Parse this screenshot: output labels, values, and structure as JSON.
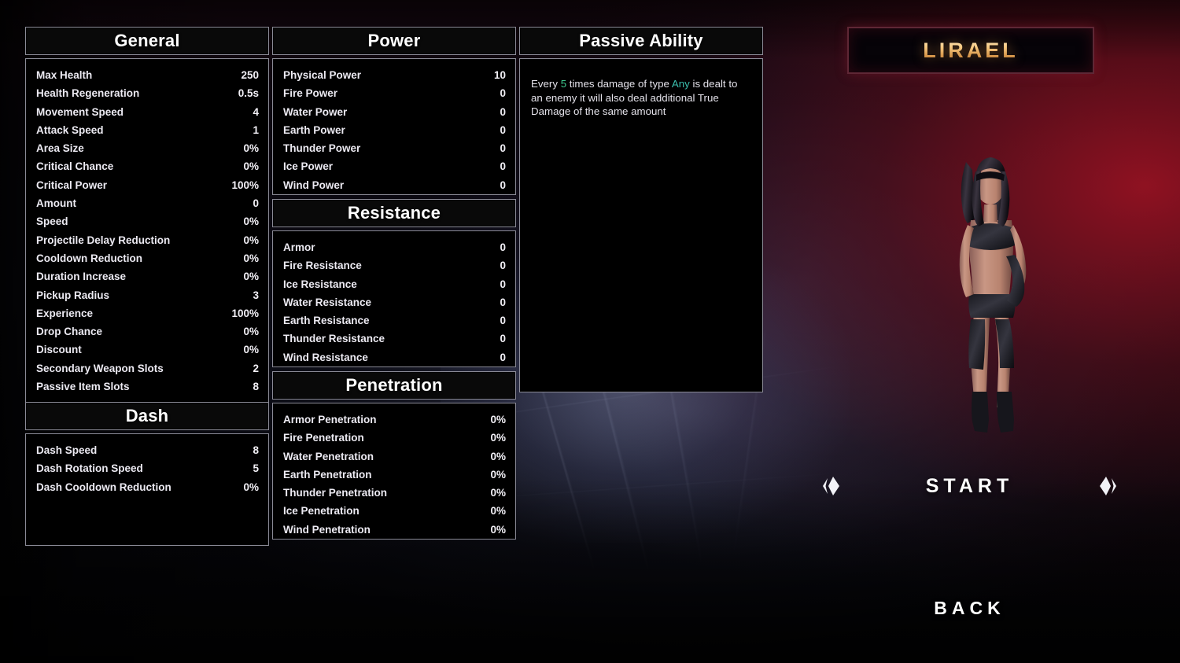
{
  "character": {
    "name": "LIRAEL"
  },
  "panels": {
    "general": {
      "title": "General",
      "rows": [
        {
          "label": "Max Health",
          "value": "250"
        },
        {
          "label": "Health Regeneration",
          "value": "0.5s"
        },
        {
          "label": "Movement Speed",
          "value": "4"
        },
        {
          "label": "Attack Speed",
          "value": "1"
        },
        {
          "label": "Area Size",
          "value": "0%"
        },
        {
          "label": "Critical Chance",
          "value": "0%"
        },
        {
          "label": "Critical Power",
          "value": "100%"
        },
        {
          "label": "Amount",
          "value": "0"
        },
        {
          "label": "Speed",
          "value": "0%"
        },
        {
          "label": "Projectile Delay Reduction",
          "value": "0%"
        },
        {
          "label": "Cooldown Reduction",
          "value": "0%"
        },
        {
          "label": "Duration Increase",
          "value": "0%"
        },
        {
          "label": "Pickup Radius",
          "value": "3"
        },
        {
          "label": "Experience",
          "value": "100%"
        },
        {
          "label": "Drop Chance",
          "value": "0%"
        },
        {
          "label": "Discount",
          "value": "0%"
        },
        {
          "label": "Secondary Weapon Slots",
          "value": "2"
        },
        {
          "label": "Passive Item Slots",
          "value": "8"
        }
      ]
    },
    "dash": {
      "title": "Dash",
      "rows": [
        {
          "label": "Dash Speed",
          "value": "8"
        },
        {
          "label": "Dash Rotation Speed",
          "value": "5"
        },
        {
          "label": "Dash Cooldown Reduction",
          "value": "0%"
        }
      ]
    },
    "power": {
      "title": "Power",
      "rows": [
        {
          "label": "Physical Power",
          "value": "10"
        },
        {
          "label": "Fire Power",
          "value": "0"
        },
        {
          "label": "Water Power",
          "value": "0"
        },
        {
          "label": "Earth Power",
          "value": "0"
        },
        {
          "label": "Thunder Power",
          "value": "0"
        },
        {
          "label": "Ice Power",
          "value": "0"
        },
        {
          "label": "Wind Power",
          "value": "0"
        }
      ]
    },
    "resistance": {
      "title": "Resistance",
      "rows": [
        {
          "label": "Armor",
          "value": "0"
        },
        {
          "label": "Fire Resistance",
          "value": "0"
        },
        {
          "label": "Ice Resistance",
          "value": "0"
        },
        {
          "label": "Water Resistance",
          "value": "0"
        },
        {
          "label": "Earth Resistance",
          "value": "0"
        },
        {
          "label": "Thunder Resistance",
          "value": "0"
        },
        {
          "label": "Wind Resistance",
          "value": "0"
        }
      ]
    },
    "penetration": {
      "title": "Penetration",
      "rows": [
        {
          "label": "Armor Penetration",
          "value": "0%"
        },
        {
          "label": "Fire Penetration",
          "value": "0%"
        },
        {
          "label": "Water Penetration",
          "value": "0%"
        },
        {
          "label": "Earth Penetration",
          "value": "0%"
        },
        {
          "label": "Thunder Penetration",
          "value": "0%"
        },
        {
          "label": "Ice Penetration",
          "value": "0%"
        },
        {
          "label": "Wind Penetration",
          "value": "0%"
        }
      ]
    },
    "passive_ability": {
      "title": "Passive Ability",
      "text_parts": {
        "p1": "Every ",
        "highlight_count": "5",
        "p2": " times damage of type ",
        "highlight_type": "Any",
        "p3": " is dealt to an enemy it will also deal additional True Damage of the same amount"
      }
    }
  },
  "buttons": {
    "start": "START",
    "back": "BACK",
    "prev_arrow": "prev-character-arrow",
    "next_arrow": "next-character-arrow"
  },
  "colors": {
    "panel_border": "#8a8a96",
    "panel_bg": "#000000",
    "name_accent": "#f6c77e",
    "name_border": "#5e2735",
    "highlight_green": "#3ec98e",
    "highlight_teal": "#3bbfae",
    "text": "#eceaf2"
  }
}
